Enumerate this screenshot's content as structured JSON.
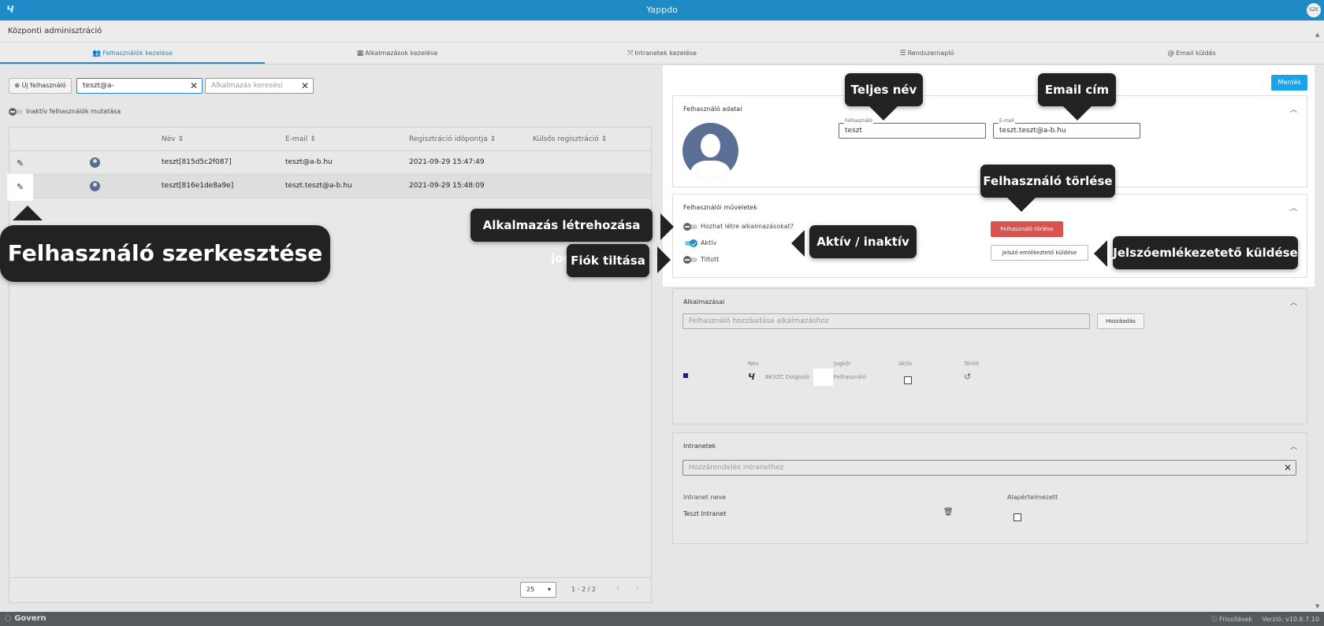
{
  "app": {
    "title": "Yappdo",
    "logo": "Ч",
    "user_initials": "SZK"
  },
  "header": {
    "title": "Központi adminisztráció"
  },
  "tabs": [
    {
      "icon": "users-icon",
      "glyph": "👥",
      "label": "Felhasználók kezelése"
    },
    {
      "icon": "apps-icon",
      "glyph": "▦",
      "label": "Alkalmazások kezelése"
    },
    {
      "icon": "network-icon",
      "glyph": "⤧",
      "label": "Intranetek kezelése"
    },
    {
      "icon": "list-icon",
      "glyph": "☰",
      "label": "Rendszernapló"
    },
    {
      "icon": "at-icon",
      "glyph": "@",
      "label": "Email küldés"
    }
  ],
  "toolbar": {
    "new_user_label": "Új felhasználó",
    "user_search_value": "teszt@a-",
    "app_search_placeholder": "Alkalmazás keresési",
    "inactive_toggle_label": "Inaktív felhasználók mutatása"
  },
  "grid": {
    "columns": [
      "Név ⇕",
      "E-mail ⇕",
      "Regisztráció időpontja ⇕",
      "Külsős regisztráció ⇕"
    ],
    "rows": [
      {
        "name": "teszt[815d5c2f087]",
        "email": "teszt@a-b.hu",
        "registered": "2021-09-29 15:47:49",
        "external": ""
      },
      {
        "name": "teszt[816e1de8a9e]",
        "email": "teszt.teszt@a-b.hu",
        "registered": "2021-09-29 15:48:09",
        "external": ""
      }
    ],
    "page_size": "25",
    "range": "1 - 2 / 2"
  },
  "detail": {
    "save_label": "Mentés",
    "user_data_title": "Felhasználó adatai",
    "username_label": "Felhasználó",
    "username_value": "teszt",
    "email_label": "E-mail",
    "email_value": "teszt.teszt@a-b.hu",
    "ops_title": "Felhasználói műveletek",
    "can_create_apps_label": "Hozhat létre alkalmazásokat?",
    "active_label": "Aktív",
    "banned_label": "Tiltott",
    "delete_button": "Felhasználó törlése",
    "send_reminder_button": "Jelszó emlékeztető küldése",
    "apps_title": "Alkalmazásai",
    "add_app_placeholder": "Felhasználó hozzáadása alkalmazáshoz",
    "add_button": "Hozzáadás",
    "apps_table_headers": {
      "name": "Név",
      "role": "Jogkör",
      "active": "Aktív",
      "deleted": "Törölt"
    },
    "app_row": {
      "name": "BKSZC Dolgozói",
      "role": "Felhasználó"
    },
    "intranet_title": "Intranetek",
    "intranet_placeholder": "Hozzárendelés intranethez",
    "intranet_headers": {
      "name": "Intranet neve",
      "default": "Alapértelmezett"
    },
    "intranet_row": {
      "name": "Teszt Intranet"
    }
  },
  "callouts": {
    "full_name": "Teljes név",
    "email": "Email cím",
    "delete_user": "Felhasználó törlése",
    "app_create_right": "Alkalmazás létrehozása jog",
    "active_inactive": "Aktív / inaktív",
    "ban_account": "Fiók tiltása",
    "password_reminder": "Jelszóemlékezetető küldése",
    "edit_user": "Felhasználó szerkesztése"
  },
  "footer": {
    "brand": "Govern",
    "updates": "Frissítések",
    "version": "Verzió: v10.6.7.10"
  },
  "colors": {
    "primary": "#1f8bc6",
    "danger": "#d9534f",
    "callout": "#222222"
  }
}
